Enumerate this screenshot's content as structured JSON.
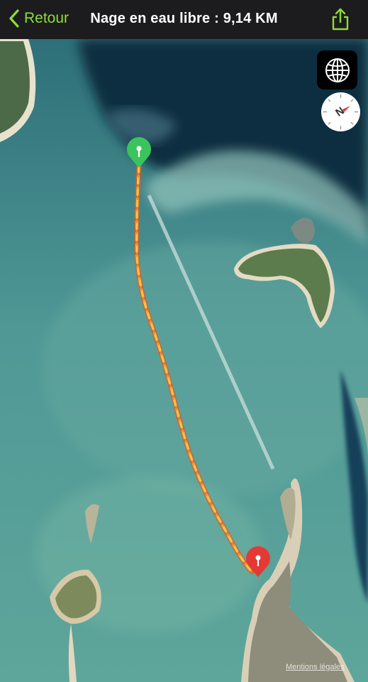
{
  "navbar": {
    "back_label": "Retour",
    "title": "Nage en eau libre : 9,14 KM",
    "share_icon": "share-icon",
    "accent_color": "#8edb3a"
  },
  "map": {
    "type": "satellite",
    "start_pin_color": "#3cc45c",
    "end_pin_color": "#e53935",
    "route_colors": [
      "#f5c242",
      "#f08c2e",
      "#e25a2a"
    ],
    "map_type_icon": "globe-icon",
    "compass_icon": "compass-icon",
    "compass_letter": "N",
    "legal_label": "Mentions légales"
  }
}
